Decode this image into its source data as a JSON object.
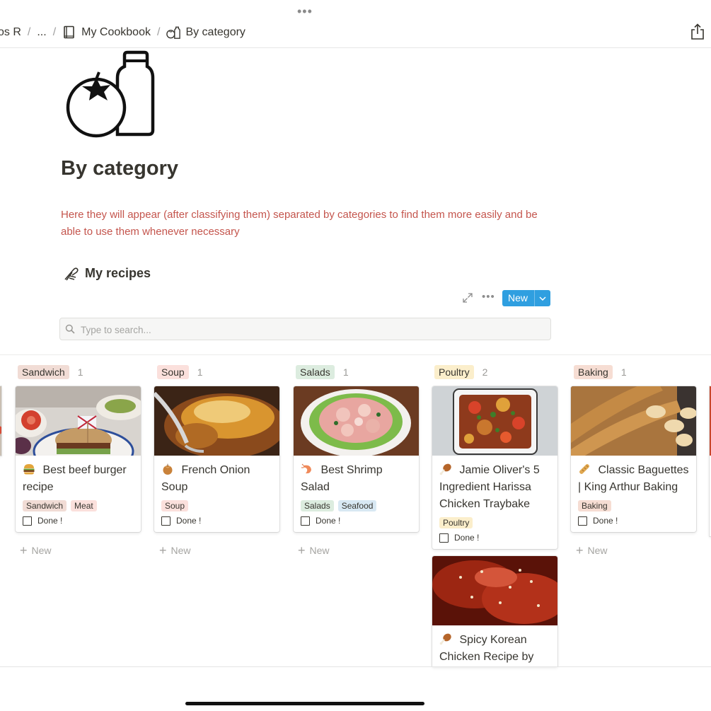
{
  "topbar": {
    "crumbs": [
      {
        "label": "os R"
      },
      {
        "label": "..."
      },
      {
        "label": "My Cookbook"
      },
      {
        "label": "By category"
      }
    ],
    "separator": "/"
  },
  "page": {
    "title": "By category",
    "description": "Here they will appear (after classifying them) separated by categories to find them more easily and be able to use them whenever necessary",
    "section_title": "My recipes"
  },
  "toolbar": {
    "new_label": "New",
    "more_label": "•••"
  },
  "search": {
    "placeholder": "Type to search..."
  },
  "board": {
    "add_new_label": "New",
    "done_label": "Done !",
    "columns": [
      {
        "name": "Sandwich",
        "count": "1",
        "color": "#f1dcd5",
        "cards": [
          {
            "title": "Best beef burger recipe",
            "tags": [
              {
                "label": "Sandwich",
                "color": "#f1dcd5"
              },
              {
                "label": "Meat",
                "color": "#fbe0dc"
              }
            ]
          }
        ]
      },
      {
        "name": "Soup",
        "count": "1",
        "color": "#fbe0dc",
        "cards": [
          {
            "title": "French Onion Soup",
            "tags": [
              {
                "label": "Soup",
                "color": "#fbe0dc"
              }
            ]
          }
        ]
      },
      {
        "name": "Salads",
        "count": "1",
        "color": "#dcecdf",
        "cards": [
          {
            "title": "Best Shrimp Salad",
            "tags": [
              {
                "label": "Salads",
                "color": "#dcecdf"
              },
              {
                "label": "Seafood",
                "color": "#d8e8f3"
              }
            ]
          }
        ]
      },
      {
        "name": "Poultry",
        "count": "2",
        "color": "#fbeecb",
        "cards": [
          {
            "title": "Jamie Oliver's 5 Ingredient Harissa Chicken Traybake",
            "tags": [
              {
                "label": "Poultry",
                "color": "#fbeecb"
              }
            ]
          },
          {
            "title": "Spicy Korean Chicken Recipe by"
          }
        ]
      },
      {
        "name": "Baking",
        "count": "1",
        "color": "#f6ddd3",
        "cards": [
          {
            "title": "Classic Baguettes | King Arthur Baking",
            "tags": [
              {
                "label": "Baking",
                "color": "#f6ddd3"
              }
            ]
          }
        ]
      }
    ]
  },
  "colors": {
    "accent": "#2f9fe0",
    "description_text": "#c4554d"
  }
}
